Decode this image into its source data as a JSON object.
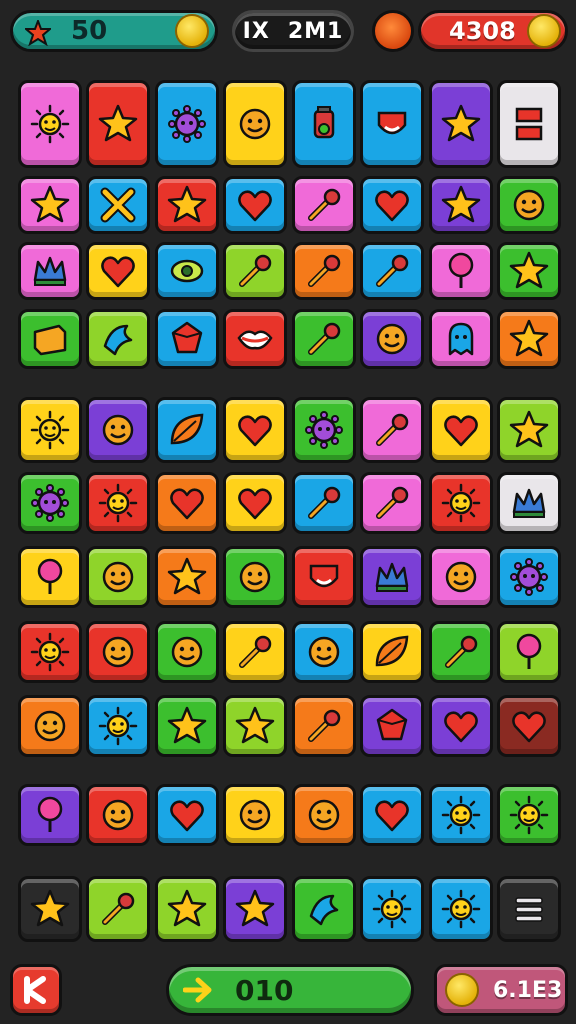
{
  "hud": {
    "score": "50",
    "mid_left": "IX",
    "mid_right": "2M1",
    "coins": "4308"
  },
  "footer": {
    "move_counter": "010",
    "bonus_value": "6.1E3"
  },
  "colors": {
    "pink": "#f06ad8",
    "red": "#e8342a",
    "blue": "#1aa6e6",
    "yellow": "#ffd21a",
    "purple": "#7b3fd6",
    "green": "#3cbf2e",
    "orange": "#f57a1a",
    "lime": "#8fd42a",
    "white": "#e9e6ea",
    "darkred": "#8a2a22",
    "navy": "#2a2a2a"
  },
  "board": {
    "rows": [
      [
        "pink:sun-icon",
        "red:star-icon",
        "blue:gear-icon",
        "yellow:face-icon",
        "blue:potion-icon",
        "blue:mask-icon",
        "purple:star-icon",
        "white:square-icon"
      ],
      [
        "pink:star-icon",
        "blue:cross-icon",
        "red:star-icon",
        "blue:heart-icon",
        "pink:wand-icon",
        "blue:heart-icon",
        "purple:star-icon",
        "green:face-icon"
      ],
      [
        "pink:crown-icon",
        "yellow:heart-icon",
        "blue:eye-icon",
        "lime:wand-icon",
        "orange:wand-icon",
        "blue:wand-icon",
        "pink:lollipop-icon",
        "green:star-icon"
      ],
      [
        "green:box-icon",
        "lime:bird-icon",
        "blue:gem-icon",
        "red:lips-icon",
        "green:wand-icon",
        "purple:face-icon",
        "pink:ghost-icon",
        "orange:star-icon"
      ],
      [
        "yellow:sun-icon",
        "purple:face-icon",
        "blue:leaf-icon",
        "yellow:heart-icon",
        "green:gear-icon",
        "pink:wand-icon",
        "yellow:heart-icon",
        "lime:star-icon"
      ],
      [
        "green:gear-icon",
        "red:sun-icon",
        "orange:heart-icon",
        "yellow:heart-icon",
        "blue:wand-icon",
        "pink:wand-icon",
        "red:sun-icon",
        "white:crown-icon"
      ],
      [
        "yellow:lollipop-icon",
        "lime:face-icon",
        "orange:star-icon",
        "green:face-icon",
        "red:mask-icon",
        "purple:crown-icon",
        "pink:face-icon",
        "blue:gear-icon"
      ],
      [
        "red:sun-icon",
        "red:face-icon",
        "green:face-icon",
        "yellow:wand-icon",
        "blue:face-icon",
        "yellow:leaf-icon",
        "green:wand-icon",
        "lime:lollipop-icon"
      ],
      [
        "orange:face-icon",
        "blue:sun-icon",
        "green:star-icon",
        "lime:star-icon",
        "orange:wand-icon",
        "purple:gem-icon",
        "purple:heart-icon",
        "darkred:heart-icon"
      ],
      [
        "purple:lollipop-icon",
        "red:face-icon",
        "blue:heart-icon",
        "yellow:face-icon",
        "orange:face-icon",
        "blue:heart-icon",
        "blue:sun-icon",
        "green:sun-icon"
      ],
      [
        "navy:star-icon",
        "lime:wand-icon",
        "lime:star-icon",
        "purple:star-icon",
        "green:bird-icon",
        "blue:sun-icon",
        "blue:sun-icon",
        "navy:menu-icon"
      ]
    ]
  }
}
